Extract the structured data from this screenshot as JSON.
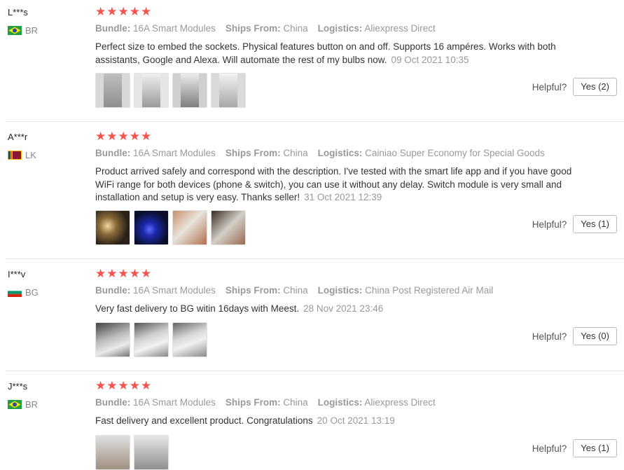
{
  "helpful_label": "Helpful?",
  "labels": {
    "bundle": "Bundle:",
    "ships_from": "Ships From:",
    "logistics": "Logistics:"
  },
  "stars": "★★★★★",
  "reviews": [
    {
      "user": "L***s",
      "country": "BR",
      "flag": "brazil-flag-icon",
      "bundle": "16A Smart Modules",
      "ships_from": "China",
      "logistics": "Aliexpress Direct",
      "text": "Perfect size to embed the sockets. Physical features button on and off. Supports 16 ampéres. Works with both assistants, Google and Alexa. Will automate the rest of my bulbs now.",
      "date": "09 Oct 2021 10:35",
      "yes": "Yes (2)",
      "photos": 4
    },
    {
      "user": "A***r",
      "country": "LK",
      "flag": "sri-lanka-flag-icon",
      "bundle": "16A Smart Modules",
      "ships_from": "China",
      "logistics": "Cainiao Super Economy for Special Goods",
      "text": "Product arrived safely and correspond with the description. I've tested with the smart life app and if you have good WiFi range for both devices (phone & switch), you can use it without any delay. Switch module is very small and installation and setup is very easy. Thanks seller!",
      "date": "31 Oct 2021 12:39",
      "yes": "Yes (1)",
      "photos": 4
    },
    {
      "user": "I***v",
      "country": "BG",
      "flag": "bulgaria-flag-icon",
      "bundle": "16A Smart Modules",
      "ships_from": "China",
      "logistics": "China Post Registered Air Mail",
      "text": "Very fast delivery to BG witin 16days with Meest.",
      "date": "28 Nov 2021 23:46",
      "yes": "Yes (0)",
      "photos": 3
    },
    {
      "user": "J***s",
      "country": "BR",
      "flag": "brazil-flag-icon",
      "bundle": "16A Smart Modules",
      "ships_from": "China",
      "logistics": "Aliexpress Direct",
      "text": "Fast delivery and excellent product. Congratulations",
      "date": "20 Oct 2021 13:19",
      "yes": "Yes (1)",
      "photos": 2
    }
  ],
  "colors": {
    "star": "#f5534d",
    "meta": "#999999",
    "divider": "#e8e8e8"
  }
}
